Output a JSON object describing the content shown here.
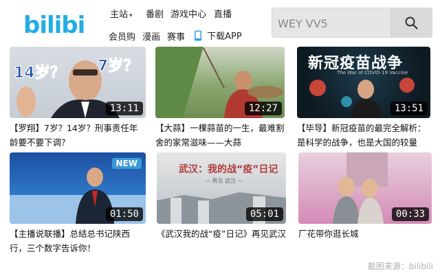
{
  "header": {
    "logo_text": "bilibili",
    "nav_row1": [
      {
        "label": "主站"
      },
      {
        "label": "番剧"
      },
      {
        "label": "游戏中心"
      },
      {
        "label": "直播"
      }
    ],
    "nav_row2": [
      {
        "label": "会员购"
      },
      {
        "label": "漫画"
      },
      {
        "label": "赛事"
      },
      {
        "label": "下载APP"
      }
    ],
    "search": {
      "value": "WEY VV5"
    }
  },
  "videos": [
    {
      "title": "【罗翔】7岁？14岁？刑事责任年龄要不要下调？",
      "duration": "13:11",
      "thumb_text_1": "14岁？",
      "thumb_text_2": "7岁？"
    },
    {
      "title": "【大蒜】一棵蒜苗的一生，最难割舍的家常滋味——大蒜",
      "duration": "12:27"
    },
    {
      "title": "【毕导】新冠疫苗的最完全解析：是科学的战争，也是大国的较量",
      "duration": "13:51",
      "thumb_text_1": "新冠疫苗战争",
      "thumb_text_2": "The War of COVID-19 Vaccine"
    },
    {
      "title": "【主播说联播】总结总书记陕西行，三个数字告诉你！",
      "duration": "01:50",
      "badge": "NEW"
    },
    {
      "title": "《武汉我的战“疫”日记》再见武汉",
      "duration": "05:01",
      "thumb_text_1": "武汉：我的战“疫”日记",
      "thumb_text_2": "— 再见 武汉 —"
    },
    {
      "title": "厂花带你逛长城",
      "duration": "00:33"
    }
  ],
  "watermark": "截图来源：bilibili",
  "colors": {
    "brand": "#23ade5",
    "text": "#111111"
  }
}
